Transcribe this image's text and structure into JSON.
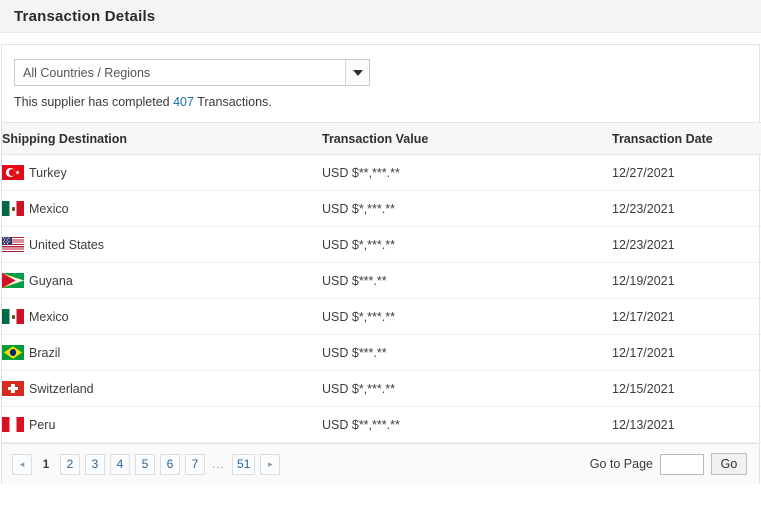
{
  "header": {
    "title": "Transaction Details"
  },
  "filter": {
    "selected_region": "All Countries / Regions",
    "arrow_icon": "chevron-down-icon"
  },
  "summary": {
    "prefix": "This supplier has completed ",
    "count": "407",
    "suffix": " Transactions."
  },
  "table": {
    "columns": [
      "Shipping Destination",
      "Transaction Value",
      "Transaction Date"
    ],
    "rows": [
      {
        "flag": "flag-turkey-icon",
        "flag_class": "flag-tr",
        "destination": "Turkey",
        "value": "USD $**,***.**",
        "date": "12/27/2021"
      },
      {
        "flag": "flag-mexico-icon",
        "flag_class": "flag-mx",
        "destination": "Mexico",
        "value": "USD $*,***.**",
        "date": "12/23/2021"
      },
      {
        "flag": "flag-united-states-icon",
        "flag_class": "flag-us",
        "destination": "United States",
        "value": "USD $*,***.**",
        "date": "12/23/2021"
      },
      {
        "flag": "flag-guyana-icon",
        "flag_class": "flag-gy",
        "destination": "Guyana",
        "value": "USD $***.**",
        "date": "12/19/2021"
      },
      {
        "flag": "flag-mexico-icon",
        "flag_class": "flag-mx",
        "destination": "Mexico",
        "value": "USD $*,***.**",
        "date": "12/17/2021"
      },
      {
        "flag": "flag-brazil-icon",
        "flag_class": "flag-br",
        "destination": "Brazil",
        "value": "USD $***.**",
        "date": "12/17/2021"
      },
      {
        "flag": "flag-switzerland-icon",
        "flag_class": "flag-ch",
        "destination": "Switzerland",
        "value": "USD $*,***.**",
        "date": "12/15/2021"
      },
      {
        "flag": "flag-peru-icon",
        "flag_class": "flag-pe",
        "destination": "Peru",
        "value": "USD $**,***.**",
        "date": "12/13/2021"
      }
    ]
  },
  "pagination": {
    "prev_icon": "◂",
    "next_icon": "▸",
    "current_page": "1",
    "pages": [
      "2",
      "3",
      "4",
      "5",
      "6",
      "7"
    ],
    "ellipsis": "...",
    "last_page": "51",
    "goto_label": "Go to Page",
    "goto_value": "",
    "goto_placeholder": "",
    "go_button": "Go"
  },
  "colors": {
    "link": "#1b6ca8",
    "pager_link": "#2a6496",
    "header_band": "#f4f4f4",
    "table_header_bg": "#f7f7f7"
  }
}
